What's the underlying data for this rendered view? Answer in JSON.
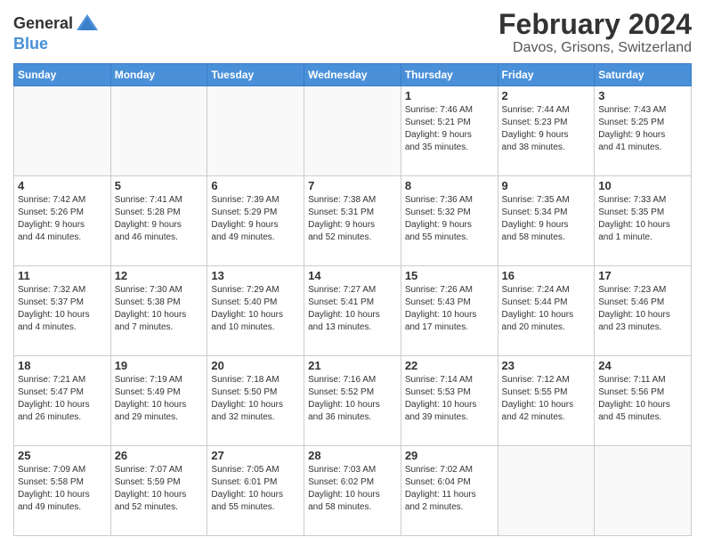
{
  "logo": {
    "line1": "General",
    "line2": "Blue"
  },
  "title": "February 2024",
  "subtitle": "Davos, Grisons, Switzerland",
  "headers": [
    "Sunday",
    "Monday",
    "Tuesday",
    "Wednesday",
    "Thursday",
    "Friday",
    "Saturday"
  ],
  "weeks": [
    [
      {
        "day": "",
        "info": ""
      },
      {
        "day": "",
        "info": ""
      },
      {
        "day": "",
        "info": ""
      },
      {
        "day": "",
        "info": ""
      },
      {
        "day": "1",
        "info": "Sunrise: 7:46 AM\nSunset: 5:21 PM\nDaylight: 9 hours\nand 35 minutes."
      },
      {
        "day": "2",
        "info": "Sunrise: 7:44 AM\nSunset: 5:23 PM\nDaylight: 9 hours\nand 38 minutes."
      },
      {
        "day": "3",
        "info": "Sunrise: 7:43 AM\nSunset: 5:25 PM\nDaylight: 9 hours\nand 41 minutes."
      }
    ],
    [
      {
        "day": "4",
        "info": "Sunrise: 7:42 AM\nSunset: 5:26 PM\nDaylight: 9 hours\nand 44 minutes."
      },
      {
        "day": "5",
        "info": "Sunrise: 7:41 AM\nSunset: 5:28 PM\nDaylight: 9 hours\nand 46 minutes."
      },
      {
        "day": "6",
        "info": "Sunrise: 7:39 AM\nSunset: 5:29 PM\nDaylight: 9 hours\nand 49 minutes."
      },
      {
        "day": "7",
        "info": "Sunrise: 7:38 AM\nSunset: 5:31 PM\nDaylight: 9 hours\nand 52 minutes."
      },
      {
        "day": "8",
        "info": "Sunrise: 7:36 AM\nSunset: 5:32 PM\nDaylight: 9 hours\nand 55 minutes."
      },
      {
        "day": "9",
        "info": "Sunrise: 7:35 AM\nSunset: 5:34 PM\nDaylight: 9 hours\nand 58 minutes."
      },
      {
        "day": "10",
        "info": "Sunrise: 7:33 AM\nSunset: 5:35 PM\nDaylight: 10 hours\nand 1 minute."
      }
    ],
    [
      {
        "day": "11",
        "info": "Sunrise: 7:32 AM\nSunset: 5:37 PM\nDaylight: 10 hours\nand 4 minutes."
      },
      {
        "day": "12",
        "info": "Sunrise: 7:30 AM\nSunset: 5:38 PM\nDaylight: 10 hours\nand 7 minutes."
      },
      {
        "day": "13",
        "info": "Sunrise: 7:29 AM\nSunset: 5:40 PM\nDaylight: 10 hours\nand 10 minutes."
      },
      {
        "day": "14",
        "info": "Sunrise: 7:27 AM\nSunset: 5:41 PM\nDaylight: 10 hours\nand 13 minutes."
      },
      {
        "day": "15",
        "info": "Sunrise: 7:26 AM\nSunset: 5:43 PM\nDaylight: 10 hours\nand 17 minutes."
      },
      {
        "day": "16",
        "info": "Sunrise: 7:24 AM\nSunset: 5:44 PM\nDaylight: 10 hours\nand 20 minutes."
      },
      {
        "day": "17",
        "info": "Sunrise: 7:23 AM\nSunset: 5:46 PM\nDaylight: 10 hours\nand 23 minutes."
      }
    ],
    [
      {
        "day": "18",
        "info": "Sunrise: 7:21 AM\nSunset: 5:47 PM\nDaylight: 10 hours\nand 26 minutes."
      },
      {
        "day": "19",
        "info": "Sunrise: 7:19 AM\nSunset: 5:49 PM\nDaylight: 10 hours\nand 29 minutes."
      },
      {
        "day": "20",
        "info": "Sunrise: 7:18 AM\nSunset: 5:50 PM\nDaylight: 10 hours\nand 32 minutes."
      },
      {
        "day": "21",
        "info": "Sunrise: 7:16 AM\nSunset: 5:52 PM\nDaylight: 10 hours\nand 36 minutes."
      },
      {
        "day": "22",
        "info": "Sunrise: 7:14 AM\nSunset: 5:53 PM\nDaylight: 10 hours\nand 39 minutes."
      },
      {
        "day": "23",
        "info": "Sunrise: 7:12 AM\nSunset: 5:55 PM\nDaylight: 10 hours\nand 42 minutes."
      },
      {
        "day": "24",
        "info": "Sunrise: 7:11 AM\nSunset: 5:56 PM\nDaylight: 10 hours\nand 45 minutes."
      }
    ],
    [
      {
        "day": "25",
        "info": "Sunrise: 7:09 AM\nSunset: 5:58 PM\nDaylight: 10 hours\nand 49 minutes."
      },
      {
        "day": "26",
        "info": "Sunrise: 7:07 AM\nSunset: 5:59 PM\nDaylight: 10 hours\nand 52 minutes."
      },
      {
        "day": "27",
        "info": "Sunrise: 7:05 AM\nSunset: 6:01 PM\nDaylight: 10 hours\nand 55 minutes."
      },
      {
        "day": "28",
        "info": "Sunrise: 7:03 AM\nSunset: 6:02 PM\nDaylight: 10 hours\nand 58 minutes."
      },
      {
        "day": "29",
        "info": "Sunrise: 7:02 AM\nSunset: 6:04 PM\nDaylight: 11 hours\nand 2 minutes."
      },
      {
        "day": "",
        "info": ""
      },
      {
        "day": "",
        "info": ""
      }
    ]
  ],
  "accent_color": "#4a90d9"
}
